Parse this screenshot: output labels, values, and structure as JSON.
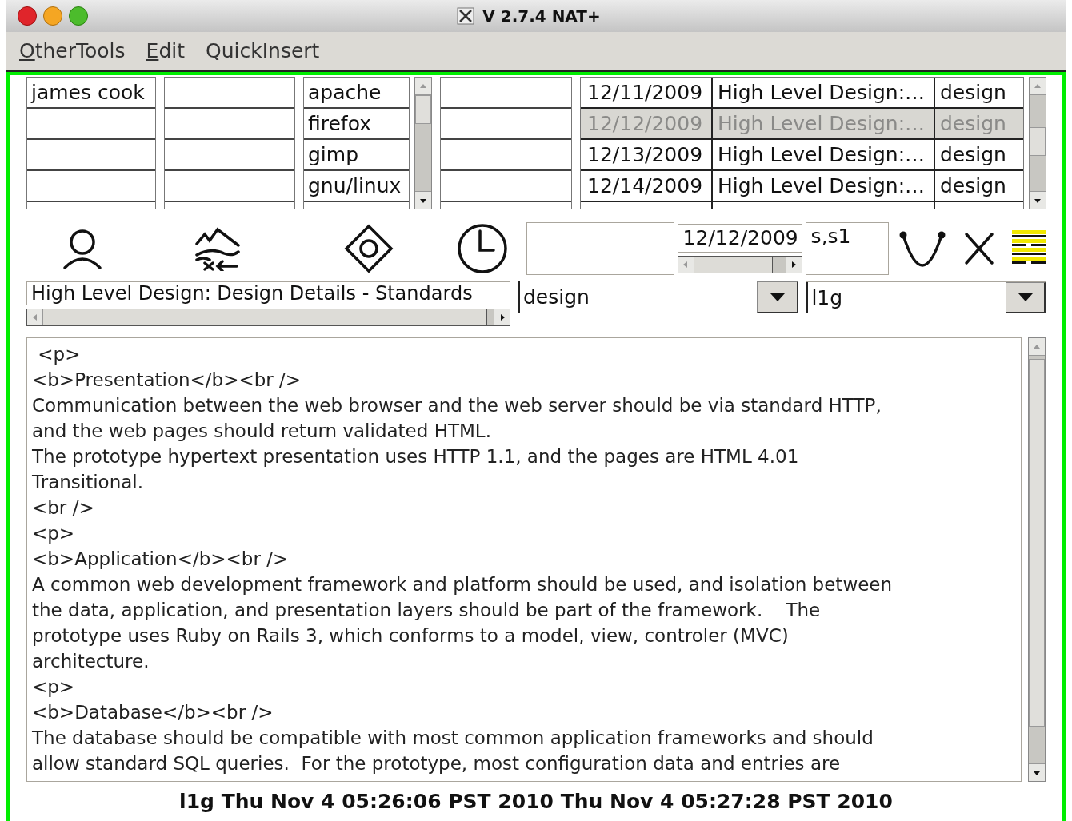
{
  "window": {
    "title": "V 2.7.4 NAT+"
  },
  "menu": [
    {
      "label": "OtherTools",
      "mnemonic": true
    },
    {
      "label": "Edit",
      "mnemonic": true
    },
    {
      "label": "QuickInsert",
      "mnemonic": false
    }
  ],
  "lists": [
    {
      "kind": "plain",
      "items": [
        "james cook"
      ]
    },
    {
      "kind": "plain"
    },
    {
      "kind": "scrolled",
      "items": [
        "apache",
        "firefox",
        "gimp",
        "gnu/linux"
      ]
    },
    {
      "kind": "plain"
    }
  ],
  "table": {
    "rows": [
      {
        "date": "12/11/2009",
        "title": "High Level Design:…",
        "type": "design",
        "selected": false
      },
      {
        "date": "12/12/2009",
        "title": "High Level Design:…",
        "type": "design",
        "selected": true
      },
      {
        "date": "12/13/2009",
        "title": "High Level Design:…",
        "type": "design",
        "selected": false
      },
      {
        "date": "12/14/2009",
        "title": "High Level Design:…",
        "type": "design",
        "selected": false
      }
    ]
  },
  "date_field": {
    "value": "12/12/2009"
  },
  "tags_field": {
    "value": "s,s1"
  },
  "title_field": {
    "value": "High Level Design: Design Details - Standards"
  },
  "type_combo": {
    "value": "design"
  },
  "user_combo": {
    "value": "l1g"
  },
  "editor": {
    "lines": [
      " <p>",
      "<b>Presentation</b><br />",
      "Communication between the web browser and the web server should be via standard HTTP,",
      "and the web pages should return validated HTML.",
      "The prototype hypertext presentation uses HTTP 1.1, and the pages are HTML 4.01",
      "Transitional.",
      "<br />",
      "<p>",
      "<b>Application</b><br />",
      "A common web development framework and platform should be used, and isolation between",
      "the data, application, and presentation layers should be part of the framework.    The",
      "prototype uses Ruby on Rails 3, which conforms to a model, view, controler (MVC)",
      "architecture.",
      "<p>",
      "<b>Database</b><br />",
      "The database should be compatible with most common application frameworks and should",
      "allow standard SQL queries.  For the prototype, most configuration data and entries are"
    ]
  },
  "status_bar": {
    "text": "l1g Thu Nov 4 05:26:06 PST 2010 Thu Nov 4 05:27:28 PST 2010"
  }
}
